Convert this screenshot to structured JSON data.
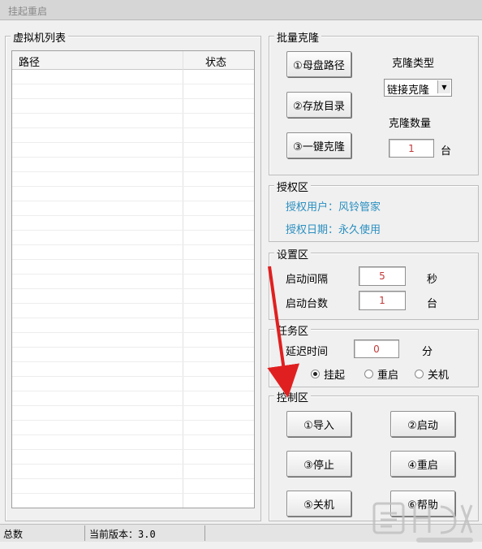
{
  "window": {
    "title": "挂起重启"
  },
  "vm_list": {
    "title": "虚拟机列表",
    "columns": [
      "路径",
      "状态"
    ]
  },
  "batch_clone": {
    "title": "批量克隆",
    "buttons": [
      "①母盘路径",
      "②存放目录",
      "③一键克隆"
    ],
    "clone_type_label": "克隆类型",
    "clone_type_value": "链接克隆",
    "clone_count_label": "克隆数量",
    "clone_count_value": "1",
    "clone_count_unit": "台"
  },
  "auth": {
    "title": "授权区",
    "user": "授权用户：风铃管家",
    "date": "授权日期：永久使用"
  },
  "settings": {
    "title": "设置区",
    "interval_label": "启动间隔",
    "interval_value": "5",
    "interval_unit": "秒",
    "count_label": "启动台数",
    "count_value": "1",
    "count_unit": "台"
  },
  "task": {
    "title": "任务区",
    "delay_label": "延迟时间",
    "delay_value": "0",
    "delay_unit": "分",
    "options": [
      "挂起",
      "重启",
      "关机"
    ],
    "selected": "挂起"
  },
  "control": {
    "title": "控制区",
    "buttons": [
      "①导入",
      "②启动",
      "③停止",
      "④重启",
      "⑤关机",
      "⑥帮助"
    ]
  },
  "statusbar": {
    "total_label": "总数",
    "version": "当前版本：3.0"
  },
  "colors": {
    "accent_text": "#2a8fc0",
    "input_text": "#c23a3a",
    "annotation_arrow": "#e02020"
  }
}
